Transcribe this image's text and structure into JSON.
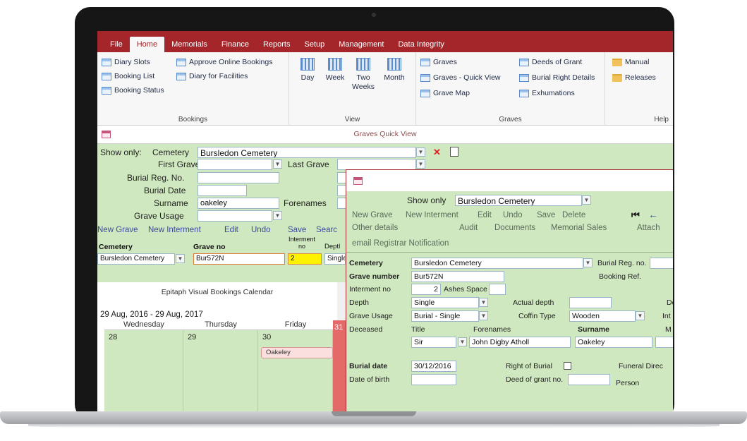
{
  "menu": [
    "File",
    "Home",
    "Memorials",
    "Finance",
    "Reports",
    "Setup",
    "Management",
    "Data Integrity"
  ],
  "ribbon": {
    "bookings": {
      "label": "Bookings",
      "items": [
        "Diary Slots",
        "Booking List",
        "Booking Status",
        "Approve Online Bookings",
        "Diary for Facilities"
      ]
    },
    "view": {
      "label": "View",
      "items": [
        "Day",
        "Week",
        "Two Weeks",
        "Month"
      ]
    },
    "graves": {
      "label": "Graves",
      "items": [
        "Graves",
        "Graves - Quick View",
        "Grave Map",
        "Deeds of Grant",
        "Burial Right Details",
        "Exhumations"
      ]
    },
    "help": {
      "label": "Help",
      "items": [
        "Manual",
        "Releases"
      ]
    }
  },
  "doc_title": "Graves Quick View",
  "search": {
    "show_only_label": "Show only:",
    "cemetery_label": "Cemetery",
    "cemetery_value": "Bursledon Cemetery",
    "first_grave_label": "First Grave",
    "last_grave_label": "Last Grave",
    "burial_reg_label": "Burial Reg. No.",
    "burial_date_label": "Burial Date",
    "surname_label": "Surname",
    "surname_value": "oakeley",
    "forenames_label": "Forenames",
    "grave_usage_label": "Grave Usage"
  },
  "toolbar": [
    "New Grave",
    "New Interment",
    "Edit",
    "Undo",
    "Save",
    "Searc"
  ],
  "grid": {
    "headers": [
      "Cemetery",
      "Grave no",
      "Interment no",
      "Deptl"
    ],
    "row": [
      "Bursledon Cemetery",
      "Bur572N",
      "2",
      "Single"
    ]
  },
  "calendar": {
    "title": "Epitaph Visual Bookings Calendar",
    "range": "29 Aug, 2016 - 29 Aug, 2017",
    "days": [
      "Wednesday",
      "Thursday",
      "Friday"
    ],
    "dates": [
      "28",
      "29",
      "30",
      "31"
    ],
    "event": "Oakeley"
  },
  "detail": {
    "show_only_label": "Show only",
    "show_only_value": "Bursledon Cemetery",
    "toolbar": [
      "New Grave",
      "New Interment",
      "Edit",
      "Undo",
      "Save",
      "Delete"
    ],
    "toolbar2": [
      "Other details",
      "Audit",
      "Documents",
      "Memorial Sales",
      "Attach"
    ],
    "notification": "email Registrar Notification",
    "cemetery_label": "Cemetery",
    "cemetery_value": "Bursledon Cemetery",
    "burial_reg_label": "Burial Reg. no.",
    "grave_number_label": "Grave number",
    "grave_number_value": "Bur572N",
    "booking_ref_label": "Booking Ref.",
    "interment_label": "Interment no",
    "interment_value": "2",
    "ashes_label": "Ashes Space",
    "depth_label": "Depth",
    "depth_value": "Single",
    "actual_depth_label": "Actual depth",
    "de_label": "De",
    "grave_usage_label": "Grave Usage",
    "grave_usage_value": "Burial - Single",
    "coffin_label": "Coffin Type",
    "coffin_value": "Wooden",
    "int_label": "Int",
    "deceased_label": "Deceased",
    "title_label": "Title",
    "forenames_label": "Forenames",
    "surname_label": "Surname",
    "m_label": "M",
    "title_value": "Sir",
    "forenames_value": "John Digby Atholl",
    "surname_value": "Oakeley",
    "burial_date_label": "Burial date",
    "burial_date_value": "30/12/2016",
    "right_of_burial_label": "Right of Burial",
    "funeral_label": "Funeral Direc",
    "dob_label": "Date of birth",
    "deed_label": "Deed of grant no.",
    "person_label": "Person"
  }
}
